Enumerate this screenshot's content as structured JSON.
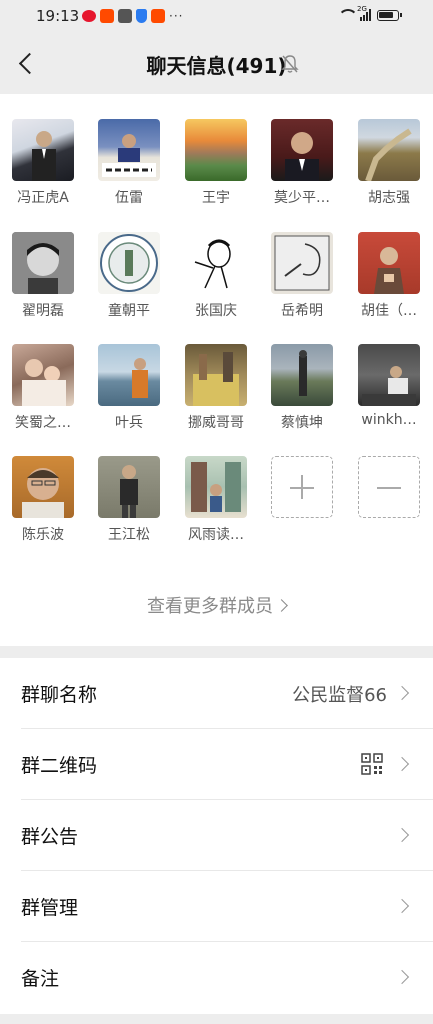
{
  "status_bar": {
    "time": "19:13",
    "network_label": "2G",
    "dots": "···"
  },
  "nav": {
    "title": "聊天信息(491)"
  },
  "members": [
    {
      "name": "冯正虎A",
      "icon": "avatar-man-suit",
      "color": "#5a6e8a"
    },
    {
      "name": "伍雷",
      "icon": "avatar-man-banner",
      "color": "#8f9fc0"
    },
    {
      "name": "王宇",
      "icon": "avatar-sunset-landscape",
      "color": "#c88a3a"
    },
    {
      "name": "莫少平…",
      "icon": "avatar-man-portrait",
      "color": "#7a4a3a"
    },
    {
      "name": "胡志强",
      "icon": "avatar-great-wall",
      "color": "#8c7a4a"
    },
    {
      "name": "翟明磊",
      "icon": "avatar-child-bw",
      "color": "#444444"
    },
    {
      "name": "童朝平",
      "icon": "avatar-emblem",
      "color": "#6c8a7a"
    },
    {
      "name": "张国庆",
      "icon": "avatar-cartoon-sketch",
      "color": "#ffffff"
    },
    {
      "name": "岳希明",
      "icon": "avatar-pencil-drawing",
      "color": "#e0dcd4"
    },
    {
      "name": "胡佳（…",
      "icon": "avatar-monk-red",
      "color": "#b03a2a"
    },
    {
      "name": "笑蜀之…",
      "icon": "avatar-family-photo",
      "color": "#a07a6a"
    },
    {
      "name": "叶兵",
      "icon": "avatar-person-sea",
      "color": "#7a9ab0"
    },
    {
      "name": "挪威哥哥",
      "icon": "avatar-market-stall",
      "color": "#8a7a4a"
    },
    {
      "name": "蔡慎坤",
      "icon": "avatar-person-field",
      "color": "#6a7a6a"
    },
    {
      "name": "winkh…",
      "icon": "avatar-person-sitting",
      "color": "#5a5a5a"
    },
    {
      "name": "陈乐波",
      "icon": "avatar-man-glasses",
      "color": "#a06a3a"
    },
    {
      "name": "王江松",
      "icon": "avatar-man-standing",
      "color": "#7a7a6a"
    },
    {
      "name": "风雨读…",
      "icon": "avatar-street-scene",
      "color": "#9ab0a0"
    }
  ],
  "more_members_label": "查看更多群成员",
  "settings": [
    {
      "label": "群聊名称",
      "value": "公民监督66"
    },
    {
      "label": "群二维码",
      "value": ""
    },
    {
      "label": "群公告",
      "value": ""
    },
    {
      "label": "群管理",
      "value": ""
    },
    {
      "label": "备注",
      "value": ""
    }
  ]
}
